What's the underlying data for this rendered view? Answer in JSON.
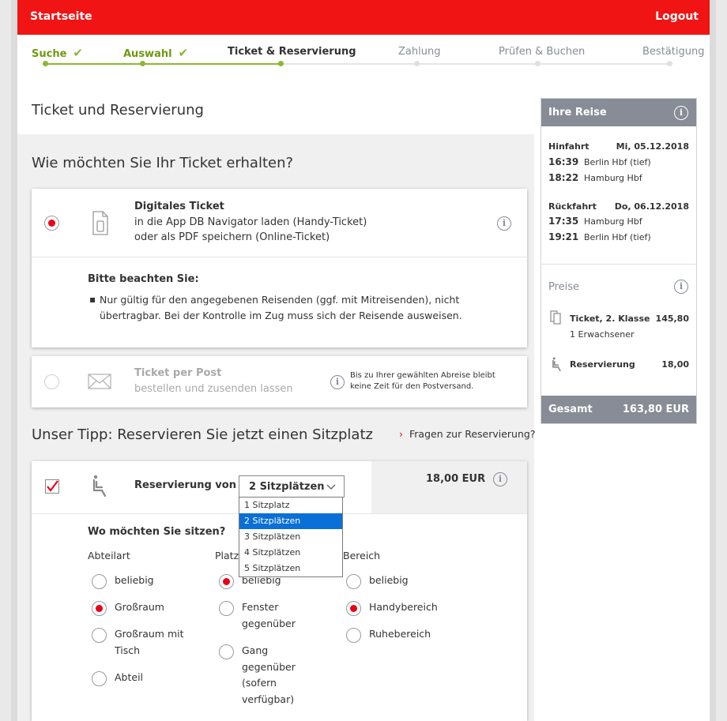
{
  "header": {
    "home": "Startseite",
    "logout": "Logout"
  },
  "steps": [
    {
      "label": "Suche",
      "state": "done"
    },
    {
      "label": "Auswahl",
      "state": "done"
    },
    {
      "label": "Ticket & Reservierung",
      "state": "current"
    },
    {
      "label": "Zahlung",
      "state": "todo"
    },
    {
      "label": "Prüfen & Buchen",
      "state": "todo"
    },
    {
      "label": "Bestätigung",
      "state": "todo"
    }
  ],
  "page_title": "Ticket und Reservierung",
  "ticket_question": "Wie möchten Sie Ihr Ticket erhalten?",
  "digital": {
    "title": "Digitales Ticket",
    "line1": "in die App DB Navigator laden (Handy-Ticket)",
    "line2": "oder als PDF speichern (Online-Ticket)",
    "note_title": "Bitte beachten Sie:",
    "note_line1": "Nur gültig für den angegebenen Reisenden (ggf. mit Mitreisenden), nicht",
    "note_line2": "übertragbar. Bei der Kontrolle im Zug muss sich der Reisende ausweisen."
  },
  "post": {
    "title": "Ticket per Post",
    "subtitle": "bestellen und zusenden lassen",
    "hint1": "Bis zu Ihrer gewählten Abreise bleibt",
    "hint2": "keine Zeit für den Postversand."
  },
  "tip": {
    "title": "Unser Tipp: Reservieren Sie jetzt einen Sitzplatz",
    "link": "Fragen zur Reservierung?"
  },
  "reservation": {
    "label": "Reservierung von",
    "selected": "2 Sitzplätzen",
    "price": "18,00 EUR",
    "options": [
      "1 Sitzplatz",
      "2 Sitzplätzen",
      "3 Sitzplätzen",
      "4 Sitzplätzen",
      "5 Sitzplätzen"
    ],
    "seat_question": "Wo möchten Sie sitzen?",
    "col1_title": "Abteilart",
    "col2_title": "Platz",
    "col3_title": "Bereich",
    "col1": [
      "beliebig",
      "Großraum",
      "Großraum mit",
      "Tisch",
      "Abteil"
    ],
    "col2": [
      "beliebig",
      "Fenster",
      "gegenüber",
      "Gang",
      "gegenüber",
      "(sofern",
      "verfügbar)"
    ],
    "col3": [
      "beliebig",
      "Handybereich",
      "Ruhebereich"
    ]
  },
  "trip": {
    "title": "Ihre Reise",
    "out_label": "Hinfahrt",
    "out_date": "Mi, 05.12.2018",
    "out_t1": "16:39",
    "out_s1": "Berlin Hbf (tief)",
    "out_t2": "18:22",
    "out_s2": "Hamburg Hbf",
    "ret_label": "Rückfahrt",
    "ret_date": "Do, 06.12.2018",
    "ret_t1": "17:35",
    "ret_s1": "Hamburg Hbf",
    "ret_t2": "19:21",
    "ret_s2": "Berlin Hbf (tief)",
    "prices_title": "Preise",
    "ticket_label": "Ticket, 2. Klasse",
    "ticket_price": "145,80",
    "ticket_sub": "1 Erwachsener",
    "res_label": "Reservierung",
    "res_price": "18,00",
    "total_label": "Gesamt",
    "total": "163,80 EUR"
  },
  "colors": {
    "brand_red": "#f01414",
    "done_green": "#6e9a10",
    "radio_red": "#ec0016",
    "side_gray": "#878c96"
  }
}
